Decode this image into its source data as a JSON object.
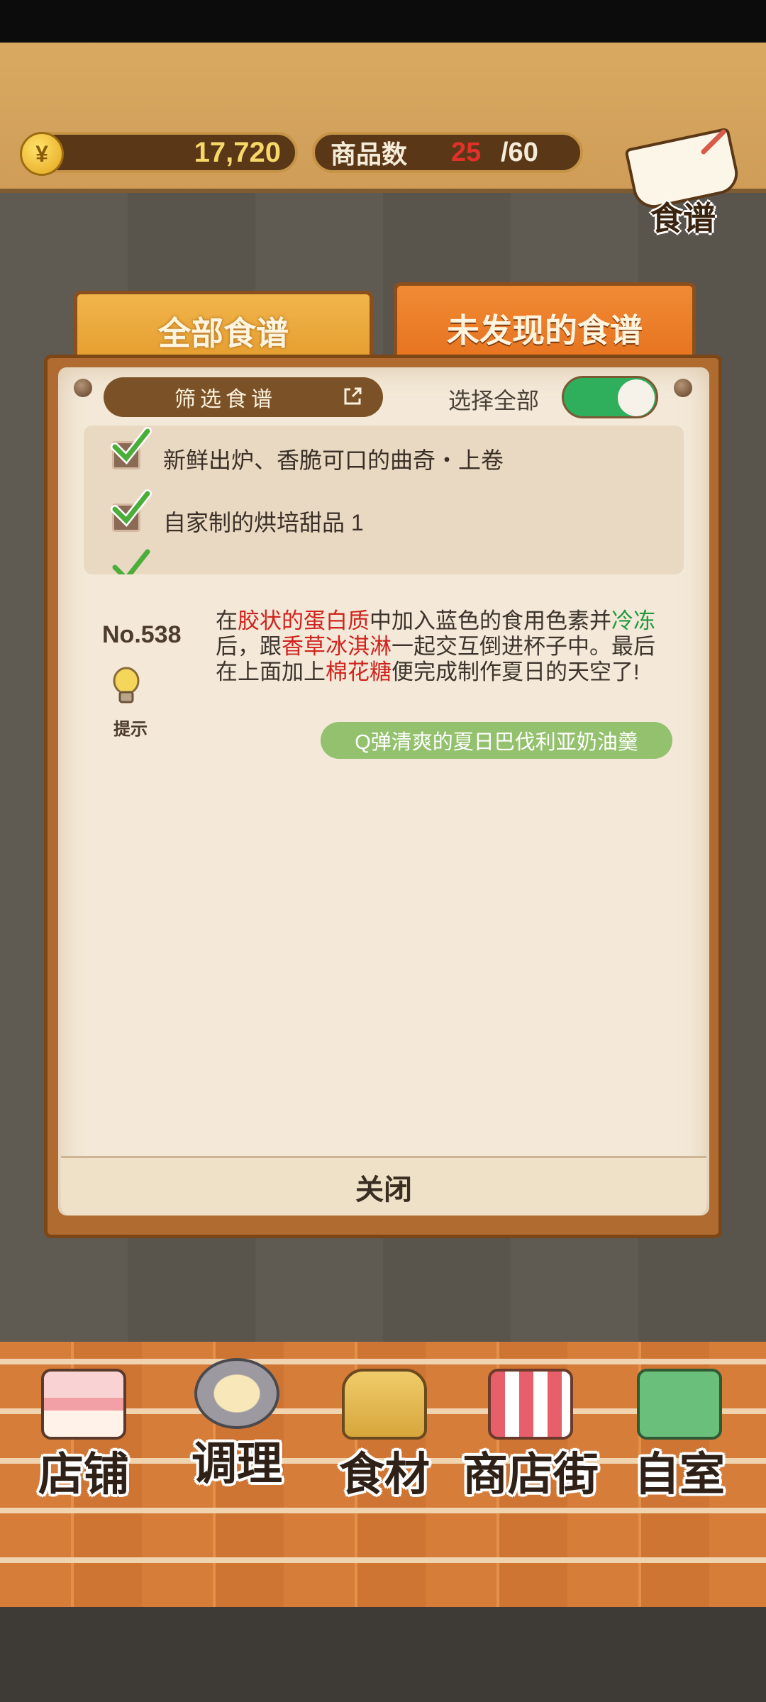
{
  "header": {
    "coin_symbol": "¥",
    "coins": "17,720",
    "product_count_label": "商品数",
    "product_count_current": "25",
    "product_count_max": "/60",
    "recipe_book_label": "食谱"
  },
  "tabs": [
    {
      "label": "全部食谱",
      "active": false
    },
    {
      "label": "未发现的食谱",
      "active": true
    }
  ],
  "filter": {
    "button_label": "筛选食谱",
    "select_all_label": "选择全部",
    "select_all_on": true,
    "items": [
      {
        "label": "新鲜出炉、香脆可口的曲奇・上卷",
        "checked": true
      },
      {
        "label": "自家制的烘培甜品 1",
        "checked": true
      }
    ]
  },
  "recipe": {
    "number": "No.538",
    "hint_label": "提示",
    "desc_parts": [
      "在",
      "胶状的蛋白质",
      "中加入蓝色的食用色素并",
      "冷冻",
      "后，跟",
      "香草冰淇淋",
      "一起交互倒进杯子中。最后在上面加上",
      "棉花糖",
      "便完成制作夏日的天空了!"
    ],
    "name": "Q弹清爽的夏日巴伐利亚奶油羹"
  },
  "close_label": "关闭",
  "nav": [
    {
      "label": "店铺",
      "icon": "cake-icon"
    },
    {
      "label": "调理",
      "icon": "mixing-bowl-icon"
    },
    {
      "label": "食材",
      "icon": "flour-sack-icon"
    },
    {
      "label": "商店街",
      "icon": "storefront-icon"
    },
    {
      "label": "自室",
      "icon": "staff-only-sign-icon"
    }
  ],
  "colors": {
    "accent_orange": "#e5701c",
    "toggle_green": "#2fae5c",
    "highlight_red": "#d0231e",
    "highlight_green": "#1f9a3f",
    "recipe_name_green": "#93c16d"
  }
}
